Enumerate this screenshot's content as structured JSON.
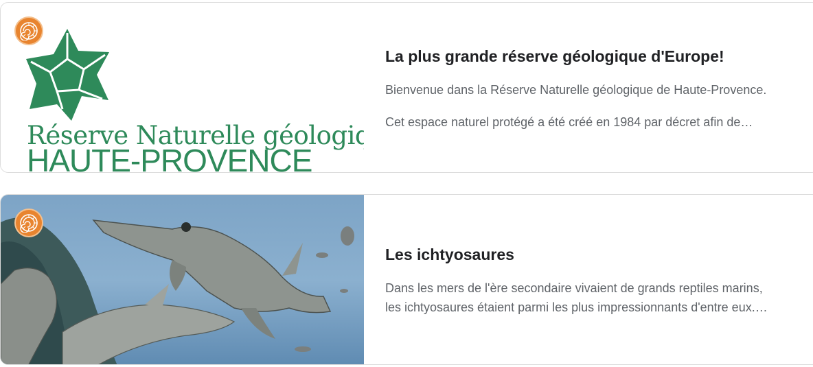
{
  "cards": [
    {
      "badge_icon": "ammonite-icon",
      "logo": {
        "line1": "Réserve Naturelle géologique",
        "line2": "HAUTE-PROVENCE"
      },
      "title": "La plus grande réserve géologique d'Europe!",
      "paragraphs": [
        "Bienvenue dans la Réserve Naturelle géologique de Haute-Provence.",
        "Cet espace naturel protégé a été créé en 1984 par décret afin de…"
      ]
    },
    {
      "badge_icon": "ammonite-icon",
      "image_icon": "ichthyosaur-illustration",
      "title": "Les ichtyosaures",
      "paragraphs": [
        "Dans les mers de l'ère secondaire vivaient de grands reptiles marins,",
        "les ichtyosaures étaient parmi les plus impressionnants d'entre eux.…"
      ]
    }
  ],
  "colors": {
    "badge": "#e8842f",
    "logo_green": "#2e8a5a",
    "title": "#202124",
    "text": "#5f6368"
  }
}
